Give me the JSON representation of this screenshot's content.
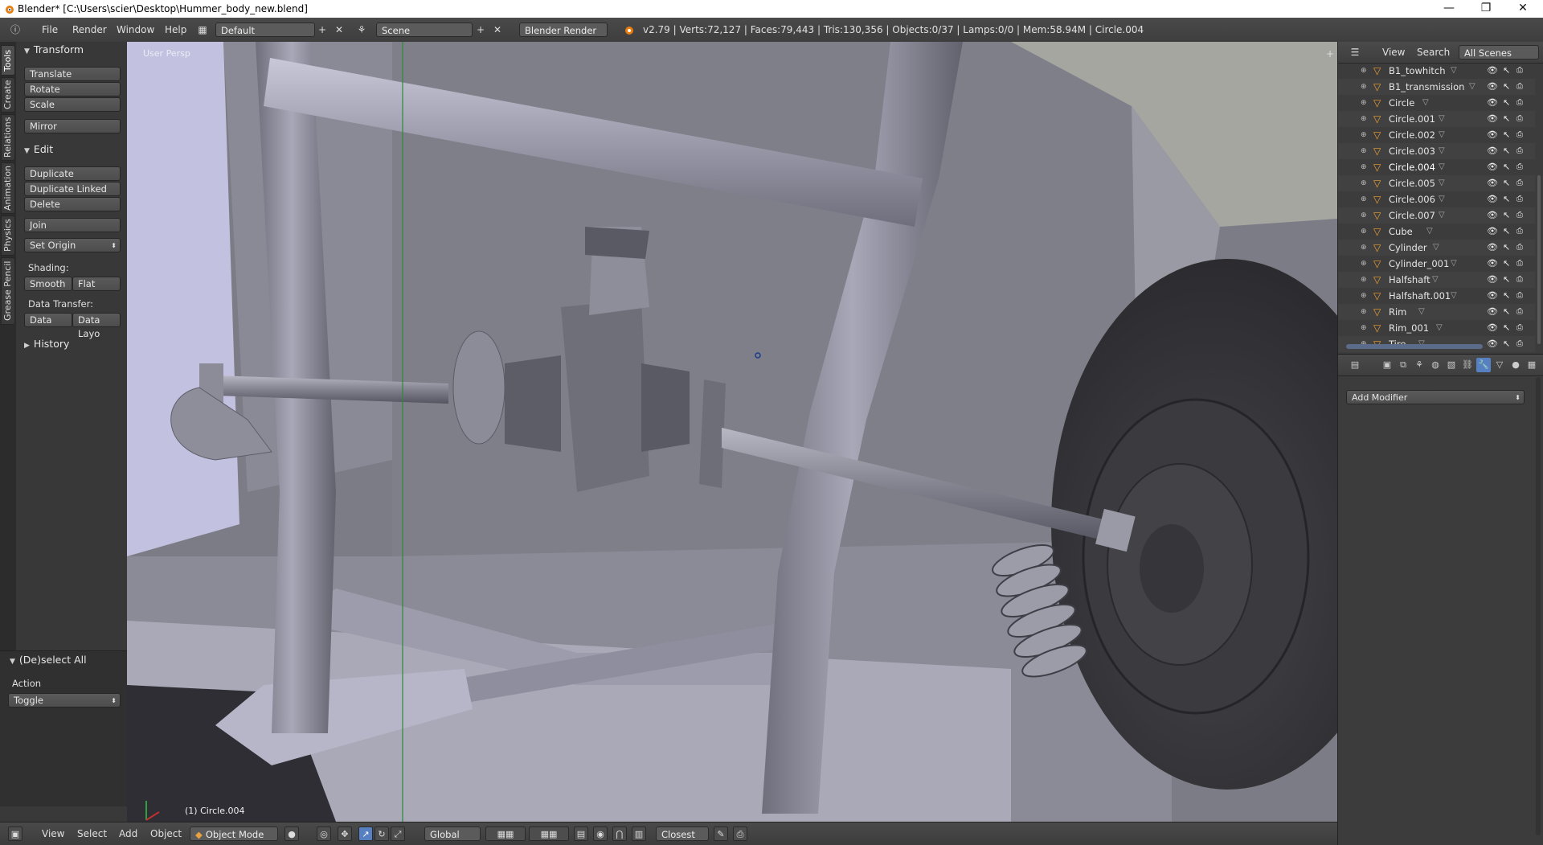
{
  "window": {
    "title": "Blender* [C:\\Users\\scier\\Desktop\\Hummer_body_new.blend]",
    "minimize": "—",
    "maximize": "❐",
    "close": "✕"
  },
  "info_header": {
    "menus": [
      "File",
      "Render",
      "Window",
      "Help"
    ],
    "screen_layout": "Default",
    "scene": "Scene",
    "render_engine": "Blender Render",
    "stats": "v2.79 | Verts:72,127 | Faces:79,443 | Tris:130,356 | Objects:0/37 | Lamps:0/0 | Mem:58.94M | Circle.004"
  },
  "tool_tabs": [
    "Tools",
    "Create",
    "Relations",
    "Animation",
    "Physics",
    "Grease Pencil"
  ],
  "tool_shelf": {
    "transform": {
      "header": "Transform",
      "buttons": [
        "Translate",
        "Rotate",
        "Scale",
        "Mirror"
      ]
    },
    "edit": {
      "header": "Edit",
      "buttons": [
        "Duplicate",
        "Duplicate Linked",
        "Delete",
        "Join"
      ],
      "set_origin": "Set Origin",
      "shading_label": "Shading:",
      "smooth": "Smooth",
      "flat": "Flat",
      "data_transfer_label": "Data Transfer:",
      "data": "Data",
      "data_layout": "Data Layo"
    },
    "history": "History"
  },
  "operator_panel": {
    "header": "(De)select All",
    "action_label": "Action",
    "action_value": "Toggle"
  },
  "viewport": {
    "view_name": "User Persp",
    "active_object": "(1) Circle.004"
  },
  "bottom_header": {
    "menus": [
      "View",
      "Select",
      "Add",
      "Object"
    ],
    "mode": "Object Mode",
    "orientation": "Global",
    "snap_target": "Closest"
  },
  "outliner": {
    "header_menus": [
      "View",
      "Search"
    ],
    "display_mode": "All Scenes",
    "items": [
      {
        "name": "B1_towhitch",
        "selected": false
      },
      {
        "name": "B1_transmission",
        "selected": false
      },
      {
        "name": "Circle",
        "selected": false
      },
      {
        "name": "Circle.001",
        "selected": false
      },
      {
        "name": "Circle.002",
        "selected": false
      },
      {
        "name": "Circle.003",
        "selected": false
      },
      {
        "name": "Circle.004",
        "selected": true
      },
      {
        "name": "Circle.005",
        "selected": false
      },
      {
        "name": "Circle.006",
        "selected": false
      },
      {
        "name": "Circle.007",
        "selected": false
      },
      {
        "name": "Cube",
        "selected": false
      },
      {
        "name": "Cylinder",
        "selected": false
      },
      {
        "name": "Cylinder_001",
        "selected": false
      },
      {
        "name": "Halfshaft",
        "selected": false
      },
      {
        "name": "Halfshaft.001",
        "selected": false
      },
      {
        "name": "Rim",
        "selected": false
      },
      {
        "name": "Rim_001",
        "selected": false
      },
      {
        "name": "Tire",
        "selected": false
      }
    ]
  },
  "properties": {
    "active_tab": "modifiers",
    "add_modifier": "Add Modifier"
  },
  "colors": {
    "accent_blue": "#5680c2",
    "object_orange": "#f0a030",
    "panel_bg": "#383838"
  }
}
